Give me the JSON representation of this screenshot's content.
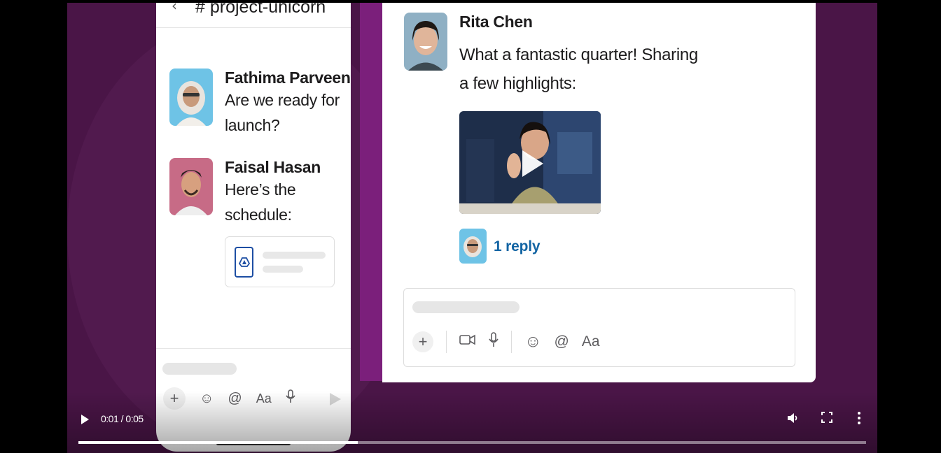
{
  "mobile": {
    "back_glyph": "‹",
    "channel": "# project-unicorn",
    "messages": [
      {
        "name": "Fathima Parveen",
        "text": "Are we ready for launch?"
      },
      {
        "name": "Faisal Hasan",
        "text": "Here’s the schedule:"
      }
    ],
    "composer_tools": [
      "+",
      "☺",
      "@",
      "Aa",
      "🎙"
    ]
  },
  "desktop": {
    "message": {
      "name": "Rita Chen",
      "text": "What a fantastic quarter! Sharing a few highlights:"
    },
    "reply_label": "1 reply",
    "composer_tools": [
      "+",
      "🎥",
      "🎙",
      "☺",
      "@",
      "Aa"
    ]
  },
  "player": {
    "time": "0:01 / 0:05",
    "progress": 0.355,
    "icons": [
      "play-icon",
      "volume-icon",
      "fullscreen-icon",
      "more-options-icon"
    ]
  },
  "colors": {
    "stage": "#4a1547",
    "purple_band": "#7b1f7b",
    "link": "#1264a3"
  }
}
